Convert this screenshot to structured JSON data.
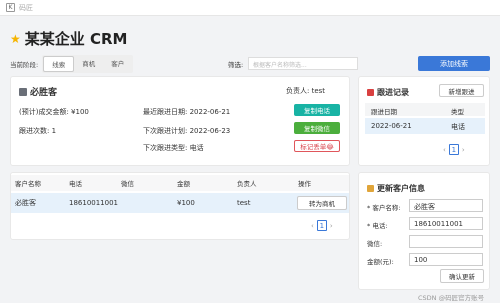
{
  "app": {
    "logo_glyph": "K",
    "name": "码匠"
  },
  "page": {
    "star_icon": "star-icon",
    "title": "某某企业 CRM"
  },
  "filters": {
    "stage_label": "当前阶段:",
    "tabs": [
      {
        "label": "线索",
        "active": true
      },
      {
        "label": "商机",
        "active": false
      },
      {
        "label": "客户",
        "active": false
      }
    ],
    "search_label": "筛选:",
    "search_placeholder": "根据客户名称筛选...",
    "add_button": "添加线索"
  },
  "customer": {
    "name": "必胜客",
    "owner_label": "负责人:",
    "owner": "test",
    "deal_amount": "(预计)成交金额: ¥100",
    "follow_count": "跟进次数: 1",
    "last_follow_date": "最近跟进日期: 2022-06-21",
    "next_follow_plan": "下次跟进计划: 2022-06-23",
    "next_follow_type": "下次跟进类型: 电话",
    "copy_phone_button": "复制电话",
    "copy_wechat_button": "复制微信",
    "mark_lost_button": "标记丢单😂"
  },
  "table": {
    "headers": [
      "客户名称",
      "电话",
      "微信",
      "金额",
      "负责人",
      "操作"
    ],
    "rows": [
      {
        "name": "必胜客",
        "phone": "18610011001",
        "wechat": "",
        "amount": "¥100",
        "owner": "test",
        "action": "转为商机"
      }
    ],
    "pager": {
      "prev": "‹",
      "page": "1",
      "next": "›"
    }
  },
  "follow_log": {
    "title": "跟进记录",
    "new_button": "新增跟进",
    "headers": [
      "跟进日期",
      "类型"
    ],
    "rows": [
      {
        "date": "2022-06-21",
        "type": "电话"
      }
    ],
    "pager": {
      "prev": "‹",
      "page": "1",
      "next": "›"
    }
  },
  "update_form": {
    "title": "更新客户信息",
    "name_label": "* 客户名称:",
    "name_value": "必胜客",
    "phone_label": "* 电话:",
    "phone_value": "18610011001",
    "wechat_label": "微信:",
    "wechat_value": "",
    "amount_label": "金额(元):",
    "amount_value": "100",
    "confirm_button": "确认更新"
  },
  "watermark": "CSDN @码匠官方账号"
}
